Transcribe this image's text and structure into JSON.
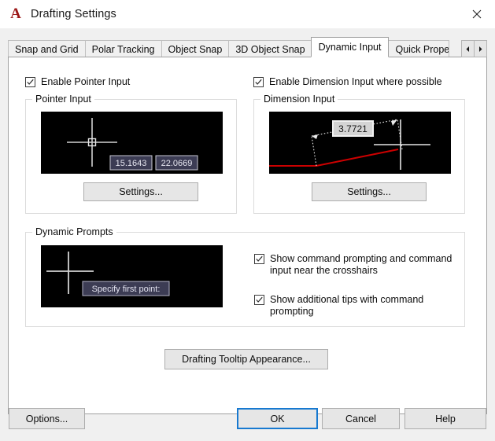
{
  "window": {
    "title": "Drafting Settings",
    "logo_letter": "A",
    "logo_color": "#9c1818",
    "close_icon": "close-icon"
  },
  "tabs": {
    "items": [
      {
        "label": "Snap and Grid",
        "active": false
      },
      {
        "label": "Polar Tracking",
        "active": false
      },
      {
        "label": "Object Snap",
        "active": false
      },
      {
        "label": "3D Object Snap",
        "active": false
      },
      {
        "label": "Dynamic Input",
        "active": true
      },
      {
        "label": "Quick Propert",
        "active": false
      }
    ],
    "scroll_left_icon": "chevron-left-icon",
    "scroll_right_icon": "chevron-right-icon"
  },
  "main": {
    "enable_pointer_input": {
      "label": "Enable Pointer Input",
      "checked": true
    },
    "enable_dimension_input": {
      "label": "Enable Dimension Input where possible",
      "checked": true
    },
    "pointer_input": {
      "group_title": "Pointer Input",
      "settings_button": "Settings...",
      "preview": {
        "tooltip_x": "15.1643",
        "tooltip_y": "22.0669",
        "tooltip_bg": "#3c3c54",
        "tooltip_border": "#c8c8d2",
        "tooltip_text_color": "#e6e6f0",
        "crosshair_color": "#d2d2d2",
        "background": "#000000"
      }
    },
    "dimension_input": {
      "group_title": "Dimension Input",
      "settings_button": "Settings...",
      "preview": {
        "dimension_value": "3.7721",
        "tooltip_bg": "#d4d4d4",
        "tooltip_border": "#f0f0f0",
        "tooltip_text_color": "#141414",
        "geometry_color": "#cc0000",
        "dim_line_color": "#e6e6e6",
        "crosshair_color": "#e6e6e6",
        "background": "#000000"
      }
    },
    "dynamic_prompts": {
      "group_title": "Dynamic Prompts",
      "preview": {
        "prompt_text": "Specify first point:",
        "tooltip_bg": "#3c3c54",
        "tooltip_border": "#b4b4c8",
        "tooltip_text_color": "#e1e1ee",
        "crosshair_color": "#d2d2d2",
        "background": "#000000"
      },
      "show_command_prompting": {
        "label": "Show command prompting and command input near the crosshairs",
        "checked": true
      },
      "show_additional_tips": {
        "label": "Show additional tips with command prompting",
        "checked": true
      }
    },
    "tooltip_appearance_button": "Drafting Tooltip Appearance..."
  },
  "footer": {
    "options_button": "Options...",
    "ok_button": "OK",
    "cancel_button": "Cancel",
    "help_button": "Help",
    "focus_color": "#1779d0"
  }
}
